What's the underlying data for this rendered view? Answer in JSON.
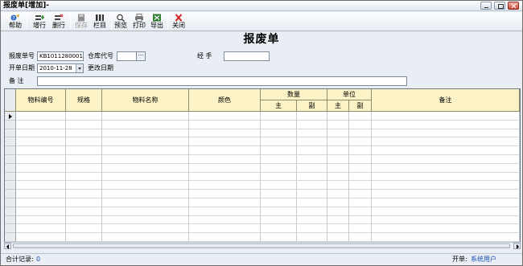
{
  "window": {
    "title": "报废单[增加]-"
  },
  "toolbar": {
    "items": [
      {
        "label": "帮助",
        "icon": "help-icon"
      },
      {
        "label": "增行",
        "icon": "add-row-icon"
      },
      {
        "label": "删行",
        "icon": "delete-row-icon"
      },
      {
        "label": "保存",
        "icon": "save-icon",
        "disabled": true
      },
      {
        "label": "栏目",
        "icon": "columns-icon"
      },
      {
        "label": "预览",
        "icon": "preview-icon"
      },
      {
        "label": "打印",
        "icon": "print-icon"
      },
      {
        "label": "导出",
        "icon": "export-icon"
      },
      {
        "label": "关闭",
        "icon": "close-icon"
      }
    ]
  },
  "page": {
    "heading": "报废单"
  },
  "form": {
    "doc_no_label": "报废单号",
    "doc_no_value": "KB1011280001",
    "warehouse_label": "仓库代号",
    "warehouse_value": "",
    "warehouse_btn": "···",
    "handler_label": "经    手",
    "handler_value": "",
    "date_label": "开单日期",
    "date_value": "2010-11-28",
    "change_date_label": "更改日期",
    "remark_label": "备    注",
    "remark_value": ""
  },
  "grid": {
    "headers": {
      "item_code": "物料编号",
      "spec": "规格",
      "item_name": "物料名称",
      "color": "颜色",
      "quantity": "数量",
      "qty_main": "主",
      "qty_sub": "副",
      "unit": "单位",
      "unit_main": "主",
      "unit_sub": "副",
      "remark": "备注"
    },
    "row_count": 16
  },
  "status": {
    "total_label": "合计记录:",
    "total_value": "0",
    "creator_label": "开单:",
    "creator_value": "系统用户"
  },
  "colors": {
    "header_bg": "#fbf3c6",
    "window_bg": "#e9eef5",
    "link_blue": "#1a4fb0"
  }
}
